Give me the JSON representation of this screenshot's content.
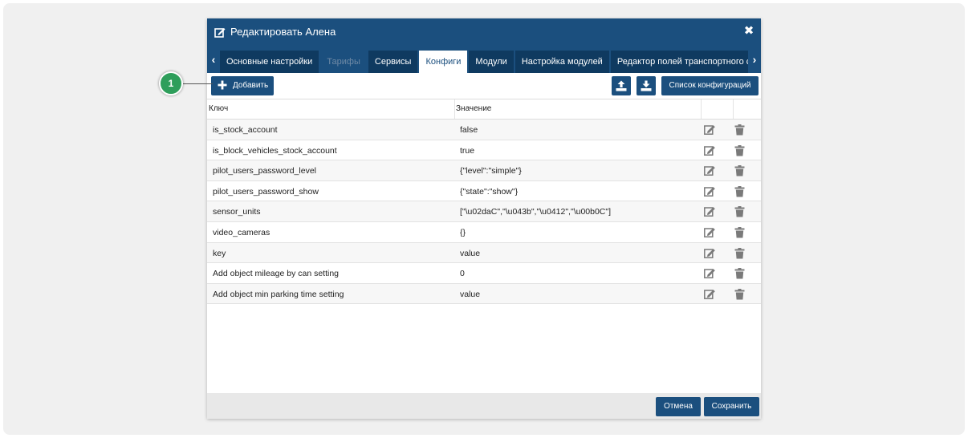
{
  "dialog": {
    "title": "Редактировать Алена",
    "close_icon": "close-icon"
  },
  "tabs": [
    {
      "label": "Основные настройки",
      "state": "normal"
    },
    {
      "label": "Тарифы",
      "state": "disabled"
    },
    {
      "label": "Сервисы",
      "state": "normal"
    },
    {
      "label": "Конфиги",
      "state": "active"
    },
    {
      "label": "Модули",
      "state": "normal"
    },
    {
      "label": "Настройка модулей",
      "state": "normal"
    },
    {
      "label": "Редактор полей транспортного сре",
      "state": "normal"
    }
  ],
  "toolbar": {
    "add_label": "Добавить",
    "config_list_label": "Список конфигураций"
  },
  "grid": {
    "columns": {
      "key": "Ключ",
      "value": "Значение"
    },
    "rows": [
      {
        "key": "is_stock_account",
        "value": "false"
      },
      {
        "key": "is_block_vehicles_stock_account",
        "value": "true"
      },
      {
        "key": "pilot_users_password_level",
        "value": "{\"level\":\"simple\"}"
      },
      {
        "key": "pilot_users_password_show",
        "value": "{\"state\":\"show\"}"
      },
      {
        "key": "sensor_units",
        "value": "[\"\\u02daC\",\"\\u043b\",\"\\u0412\",\"\\u00b0C\"]"
      },
      {
        "key": "video_cameras",
        "value": "{}"
      },
      {
        "key": "key",
        "value": "value"
      },
      {
        "key": "Add object mileage by can setting",
        "value": "0"
      },
      {
        "key": "Add object min parking time setting",
        "value": "value"
      }
    ]
  },
  "footer": {
    "cancel_label": "Отмена",
    "save_label": "Сохранить"
  },
  "callout": {
    "number": "1"
  },
  "colors": {
    "primary": "#1b4f7e",
    "tab_dark": "#0f3a60",
    "callout": "#2e9e5b",
    "icon_gray": "#7a7a7a"
  }
}
